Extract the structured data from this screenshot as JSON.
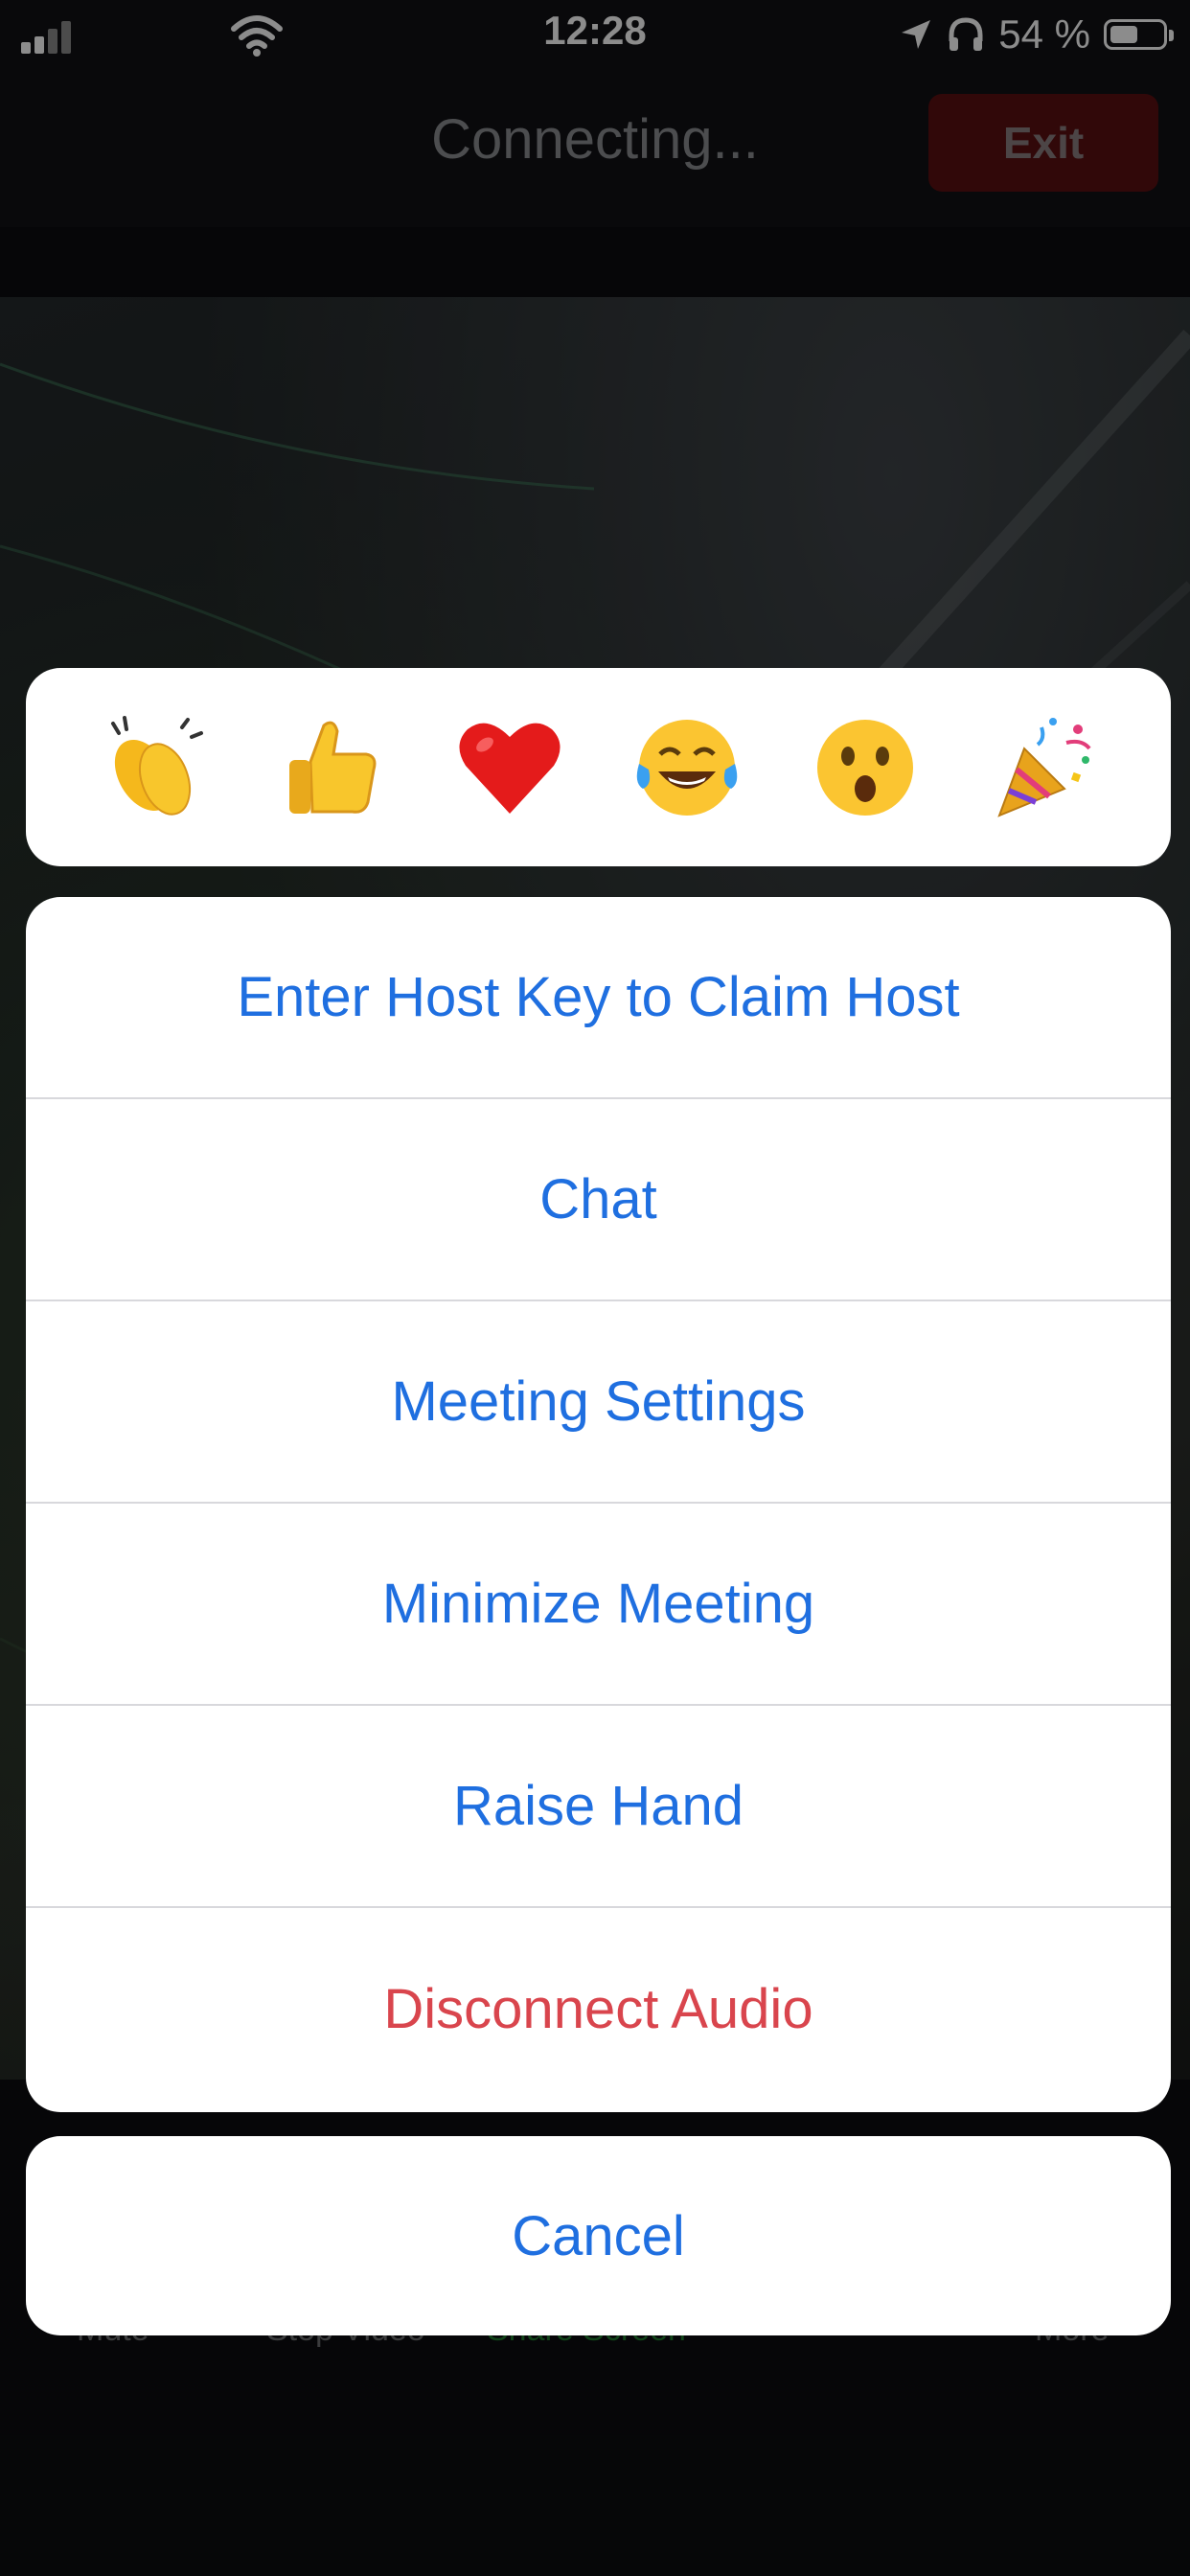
{
  "status_bar": {
    "time": "12:28",
    "battery_percent": "54 %",
    "battery_level": 0.54,
    "icons": [
      "signal-icon",
      "wifi-icon",
      "location-icon",
      "headphones-icon",
      "battery-icon"
    ]
  },
  "meeting": {
    "status_text": "Connecting...",
    "exit_label": "Exit"
  },
  "toolbar": {
    "items": [
      "Mute",
      "Stop Video",
      "Share Screen",
      "",
      "More"
    ]
  },
  "reactions": [
    {
      "name": "clapping-hands"
    },
    {
      "name": "thumbs-up"
    },
    {
      "name": "red-heart"
    },
    {
      "name": "tears-of-joy"
    },
    {
      "name": "open-mouth"
    },
    {
      "name": "party-popper"
    }
  ],
  "menu": {
    "items": [
      {
        "label": "Enter Host Key to Claim Host",
        "style": "default"
      },
      {
        "label": "Chat",
        "style": "default"
      },
      {
        "label": "Meeting Settings",
        "style": "default"
      },
      {
        "label": "Minimize Meeting",
        "style": "default"
      },
      {
        "label": "Raise Hand",
        "style": "default"
      },
      {
        "label": "Disconnect Audio",
        "style": "destructive"
      }
    ],
    "cancel_label": "Cancel"
  },
  "colors": {
    "action_blue": "#1f6fe0",
    "destructive_red": "#d9454d",
    "exit_button_bg": "#5a0f12",
    "share_screen_green": "#1f7a2e"
  }
}
